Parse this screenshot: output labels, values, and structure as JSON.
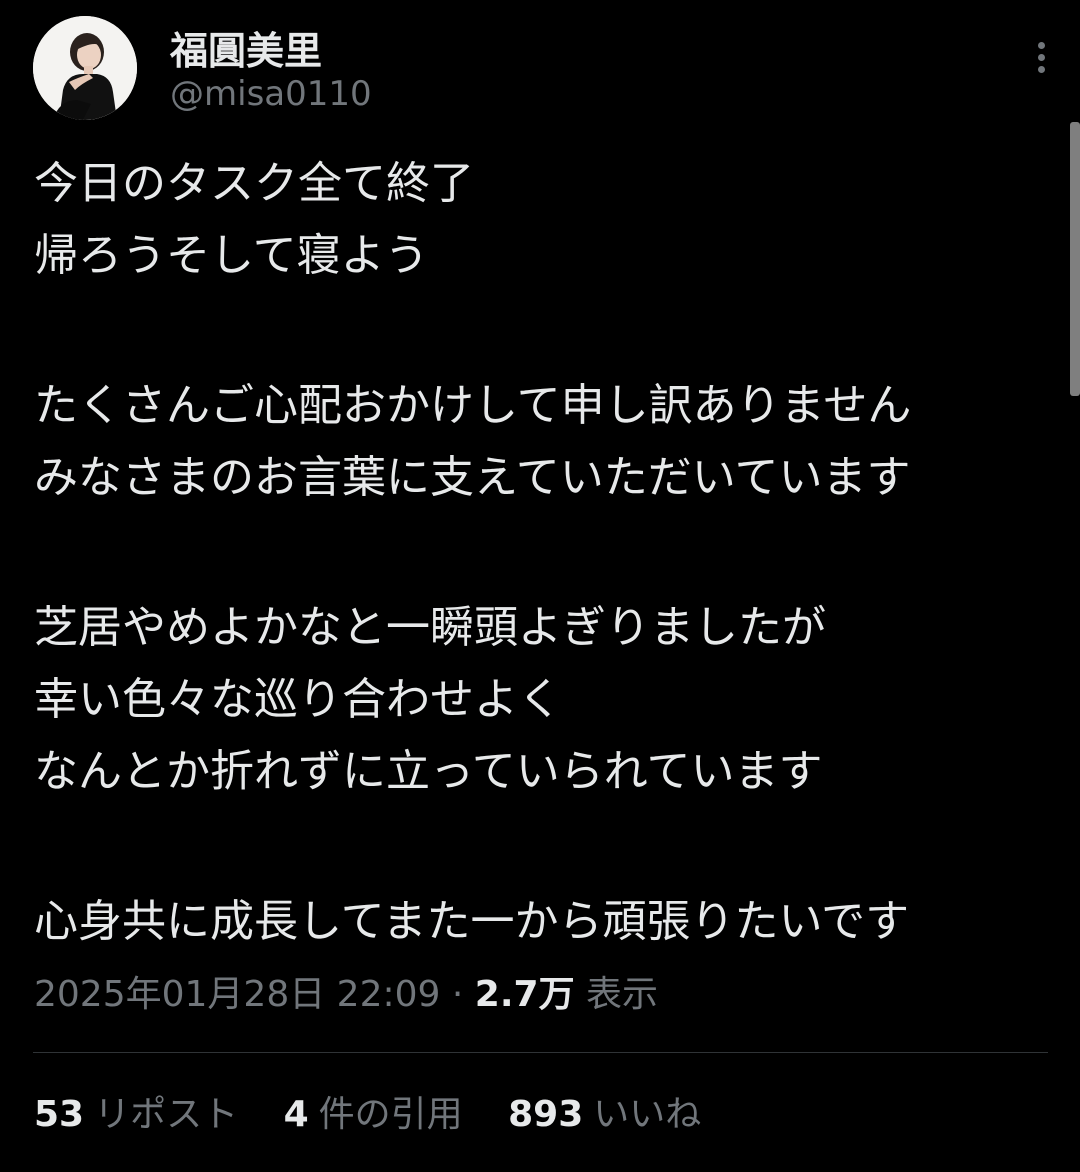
{
  "user": {
    "display_name": "福圓美里",
    "handle": "@misa0110"
  },
  "tweet": {
    "lines": [
      "今日のタスク全て終了",
      "帰ろうそして寝よう",
      "",
      "たくさんご心配おかけして申し訳ありません",
      "みなさまのお言葉に支えていただいています",
      "",
      "芝居やめよかなと一瞬頭よぎりましたが",
      "幸い色々な巡り合わせよく",
      "なんとか折れずに立っていられています",
      "",
      "心身共に成長してまた一から頑張りたいです"
    ]
  },
  "meta": {
    "timestamp": "2025年01月28日 22:09",
    "separator": "·",
    "views_count": "2.7万",
    "views_label": "表示"
  },
  "stats": {
    "reposts_count": "53",
    "reposts_label": "リポスト",
    "quotes_count": "4",
    "quotes_label": "件の引用",
    "likes_count": "893",
    "likes_label": "いいね"
  },
  "icons": {
    "more": "more-vertical-icon",
    "avatar": "avatar-photo"
  },
  "colors": {
    "background": "#000000",
    "text_primary": "#e7e9ea",
    "text_secondary": "#71767b",
    "divider": "#2f3336"
  }
}
